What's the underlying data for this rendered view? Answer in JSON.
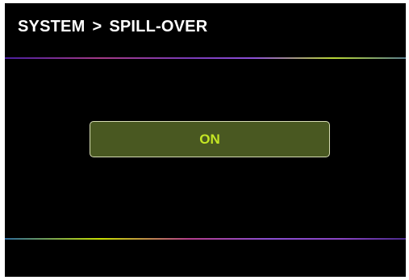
{
  "header": {
    "section": "SYSTEM",
    "separator": ">",
    "page": "SPILL-OVER"
  },
  "setting": {
    "value_label": "ON"
  },
  "colors": {
    "background": "#000000",
    "title_text": "#ffffff",
    "button_fill": "#495821",
    "button_border": "#d7ddb4",
    "button_text": "#c4e624"
  }
}
